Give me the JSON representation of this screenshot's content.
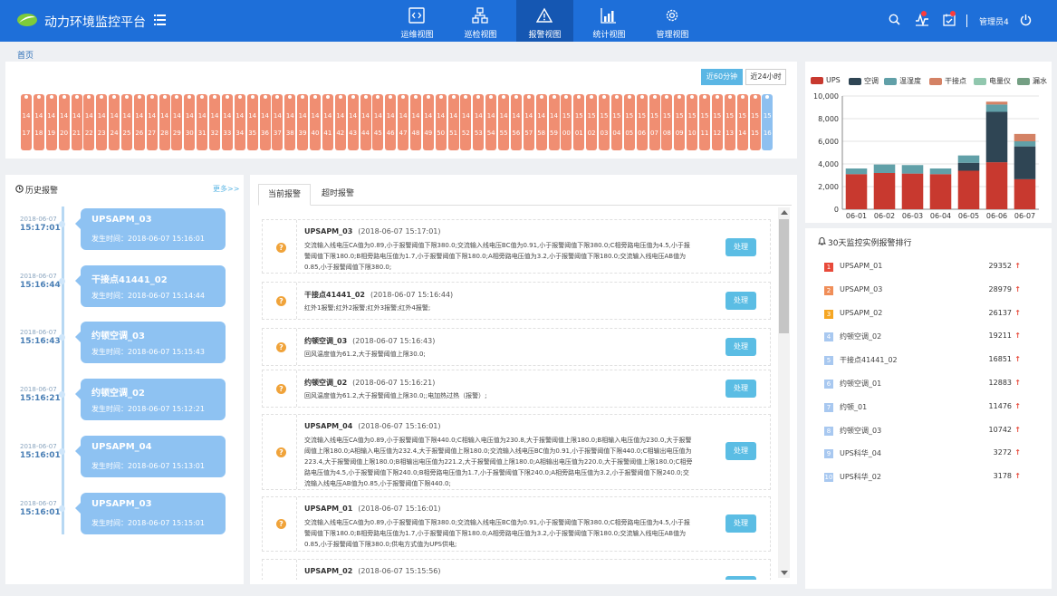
{
  "header": {
    "title": "动力环境监控平台",
    "nav": [
      {
        "label": "运维视图",
        "icon": "code-window-icon",
        "active": false
      },
      {
        "label": "巡检视图",
        "icon": "org-chart-icon",
        "active": false
      },
      {
        "label": "报警视图",
        "icon": "warning-icon",
        "active": true
      },
      {
        "label": "统计视图",
        "icon": "bar-chart-icon",
        "active": false
      },
      {
        "label": "管理视图",
        "icon": "gear-icon",
        "active": false
      }
    ],
    "user": "管理员4",
    "icons": [
      "search-icon",
      "alarm-pulse-icon",
      "calendar-check-icon",
      "power-icon"
    ],
    "colors": {
      "header_bg": "#1e6fd9",
      "nav_active_bg": "#1557b2",
      "badge": "#ff3b3b"
    }
  },
  "breadcrumb": "首页",
  "range_buttons": [
    {
      "label": "近60分钟",
      "active": true
    },
    {
      "label": "近24小时",
      "active": false
    }
  ],
  "minute_ticks": [
    {
      "h": "14",
      "m": "17",
      "c": "o"
    },
    {
      "h": "14",
      "m": "18",
      "c": "o"
    },
    {
      "h": "14",
      "m": "19",
      "c": "o"
    },
    {
      "h": "14",
      "m": "20",
      "c": "o"
    },
    {
      "h": "14",
      "m": "21",
      "c": "o"
    },
    {
      "h": "14",
      "m": "22",
      "c": "o"
    },
    {
      "h": "14",
      "m": "23",
      "c": "o"
    },
    {
      "h": "14",
      "m": "24",
      "c": "o"
    },
    {
      "h": "14",
      "m": "25",
      "c": "o"
    },
    {
      "h": "14",
      "m": "26",
      "c": "o"
    },
    {
      "h": "14",
      "m": "27",
      "c": "o"
    },
    {
      "h": "14",
      "m": "28",
      "c": "o"
    },
    {
      "h": "14",
      "m": "29",
      "c": "o"
    },
    {
      "h": "14",
      "m": "30",
      "c": "o"
    },
    {
      "h": "14",
      "m": "31",
      "c": "o"
    },
    {
      "h": "14",
      "m": "32",
      "c": "o"
    },
    {
      "h": "14",
      "m": "33",
      "c": "o"
    },
    {
      "h": "14",
      "m": "34",
      "c": "o"
    },
    {
      "h": "14",
      "m": "35",
      "c": "o"
    },
    {
      "h": "14",
      "m": "36",
      "c": "o"
    },
    {
      "h": "14",
      "m": "37",
      "c": "o"
    },
    {
      "h": "14",
      "m": "38",
      "c": "o"
    },
    {
      "h": "14",
      "m": "39",
      "c": "o"
    },
    {
      "h": "14",
      "m": "40",
      "c": "o"
    },
    {
      "h": "14",
      "m": "41",
      "c": "o"
    },
    {
      "h": "14",
      "m": "42",
      "c": "o"
    },
    {
      "h": "14",
      "m": "43",
      "c": "o"
    },
    {
      "h": "14",
      "m": "44",
      "c": "o"
    },
    {
      "h": "14",
      "m": "45",
      "c": "o"
    },
    {
      "h": "14",
      "m": "46",
      "c": "o"
    },
    {
      "h": "14",
      "m": "47",
      "c": "o"
    },
    {
      "h": "14",
      "m": "48",
      "c": "o"
    },
    {
      "h": "14",
      "m": "49",
      "c": "o"
    },
    {
      "h": "14",
      "m": "50",
      "c": "o"
    },
    {
      "h": "14",
      "m": "51",
      "c": "o"
    },
    {
      "h": "14",
      "m": "52",
      "c": "o"
    },
    {
      "h": "14",
      "m": "53",
      "c": "o"
    },
    {
      "h": "14",
      "m": "54",
      "c": "o"
    },
    {
      "h": "14",
      "m": "55",
      "c": "o"
    },
    {
      "h": "14",
      "m": "56",
      "c": "o"
    },
    {
      "h": "14",
      "m": "57",
      "c": "o"
    },
    {
      "h": "14",
      "m": "58",
      "c": "o"
    },
    {
      "h": "14",
      "m": "59",
      "c": "o"
    },
    {
      "h": "15",
      "m": "00",
      "c": "o"
    },
    {
      "h": "15",
      "m": "01",
      "c": "o"
    },
    {
      "h": "15",
      "m": "02",
      "c": "o"
    },
    {
      "h": "15",
      "m": "03",
      "c": "o"
    },
    {
      "h": "15",
      "m": "04",
      "c": "o"
    },
    {
      "h": "15",
      "m": "05",
      "c": "o"
    },
    {
      "h": "15",
      "m": "06",
      "c": "o"
    },
    {
      "h": "15",
      "m": "07",
      "c": "o"
    },
    {
      "h": "15",
      "m": "08",
      "c": "o"
    },
    {
      "h": "15",
      "m": "09",
      "c": "o"
    },
    {
      "h": "15",
      "m": "10",
      "c": "o"
    },
    {
      "h": "15",
      "m": "11",
      "c": "o"
    },
    {
      "h": "15",
      "m": "12",
      "c": "o"
    },
    {
      "h": "15",
      "m": "13",
      "c": "o"
    },
    {
      "h": "15",
      "m": "14",
      "c": "o"
    },
    {
      "h": "15",
      "m": "15",
      "c": "o"
    },
    {
      "h": "15",
      "m": "16",
      "c": "b"
    }
  ],
  "history": {
    "title": "历史报警",
    "more": "更多>>",
    "items": [
      {
        "date": "2018-06-07",
        "time": "15:17:01",
        "name": "UPSAPM_03",
        "occurred": "发生时间：2018-06-07 15:16:01"
      },
      {
        "date": "2018-06-07",
        "time": "15:16:44",
        "name": "干接点41441_02",
        "occurred": "发生时间：2018-06-07 15:14:44"
      },
      {
        "date": "2018-06-07",
        "time": "15:16:43",
        "name": "约顿空调_03",
        "occurred": "发生时间：2018-06-07 15:15:43"
      },
      {
        "date": "2018-06-07",
        "time": "15:16:21",
        "name": "约顿空调_02",
        "occurred": "发生时间：2018-06-07 15:12:21"
      },
      {
        "date": "2018-06-07",
        "time": "15:16:01",
        "name": "UPSAPM_04",
        "occurred": "发生时间：2018-06-07 15:13:01"
      },
      {
        "date": "2018-06-07",
        "time": "15:16:01",
        "name": "UPSAPM_03",
        "occurred": "发生时间：2018-06-07 15:15:01"
      }
    ]
  },
  "alarms": {
    "tabs": [
      {
        "label": "当前报警",
        "active": true
      },
      {
        "label": "超时报警",
        "active": false
      }
    ],
    "action_label": "处理",
    "items": [
      {
        "name": "UPSAPM_03",
        "time": "(2018-06-07 15:17:01)",
        "desc": "交流输入线电压CA值为0.89,小于报警阈值下限380.0;交流输入线电压BC值为0.91,小于报警阈值下限380.0;C相旁路电压值为4.5,小于报警阈值下限180.0;B相旁路电压值为1.7,小于报警阈值下限180.0;A相旁路电压值为3.2,小于报警阈值下限180.0;交流输入线电压AB值为0.85,小于报警阈值下限380.0;"
      },
      {
        "name": "干接点41441_02",
        "time": "(2018-06-07 15:16:44)",
        "desc": "红外1报警;红外2报警;红外3报警;红外4报警;"
      },
      {
        "name": "约顿空调_03",
        "time": "(2018-06-07 15:16:43)",
        "desc": "回风温度值为61.2,大于报警阈值上限30.0;"
      },
      {
        "name": "约顿空调_02",
        "time": "(2018-06-07 15:16:21)",
        "desc": "回风温度值为61.2,大于报警阈值上限30.0;;电加热过热（报警）;"
      },
      {
        "name": "UPSAPM_04",
        "time": "(2018-06-07 15:16:01)",
        "desc": "交流输入线电压CA值为0.89,小于报警阈值下限440.0;C相输入电压值为230.8,大于报警阈值上限180.0;B相输入电压值为230.0,大于报警阈值上限180.0;A相输入电压值为232.4,大于报警阈值上限180.0;交流输入线电压BC值为0.91,小于报警阈值下限440.0;C相输出电压值为223.4,大于报警阈值上限180.0;B相输出电压值为221.2,大于报警阈值上限180.0;A相输出电压值为220.0,大于报警阈值上限180.0;C相旁路电压值为4.5,小于报警阈值下限240.0;B相旁路电压值为1.7,小于报警阈值下限240.0;A相旁路电压值为3.2,小于报警阈值下限240.0;交流输入线电压AB值为0.85,小于报警阈值下限440.0;"
      },
      {
        "name": "UPSAPM_01",
        "time": "(2018-06-07 15:16:01)",
        "desc": "交流输入线电压CA值为0.89,小于报警阈值下限380.0;交流输入线电压BC值为0.91,小于报警阈值下限380.0;C相旁路电压值为4.5,小于报警阈值下限180.0;B相旁路电压值为1.7,小于报警阈值下限180.0;A相旁路电压值为3.2,小于报警阈值下限180.0;交流输入线电压AB值为0.85,小于报警阈值下限380.0;供电方式值为UPS供电;"
      },
      {
        "name": "UPSAPM_02",
        "time": "(2018-06-07 15:15:56)",
        "desc": ""
      }
    ]
  },
  "chart_data": {
    "type": "bar",
    "stacked": true,
    "categories": [
      "06-01",
      "06-02",
      "06-03",
      "06-04",
      "06-05",
      "06-06",
      "06-07"
    ],
    "series": [
      {
        "name": "UPS",
        "color": "#c8392f",
        "values": [
          3100,
          3200,
          3150,
          3100,
          3400,
          4150,
          2650
        ]
      },
      {
        "name": "空调",
        "color": "#2f4554",
        "values": [
          0,
          0,
          0,
          0,
          700,
          4450,
          2900
        ]
      },
      {
        "name": "温湿度",
        "color": "#61a0a8",
        "values": [
          500,
          750,
          750,
          500,
          650,
          650,
          450
        ]
      },
      {
        "name": "干接点",
        "color": "#d48265",
        "values": [
          0,
          0,
          0,
          0,
          0,
          250,
          650
        ]
      },
      {
        "name": "电量仪",
        "color": "#91c7ae",
        "values": [
          0,
          0,
          0,
          0,
          0,
          0,
          0
        ]
      },
      {
        "name": "漏水",
        "color": "#749f83",
        "values": [
          0,
          0,
          0,
          0,
          0,
          0,
          0
        ]
      }
    ],
    "ylim": [
      0,
      10000
    ],
    "yticks": [
      "0",
      "2,000",
      "4,000",
      "6,000",
      "8,000",
      "10,000"
    ],
    "ytick_values": [
      0,
      2000,
      4000,
      6000,
      8000,
      10000
    ],
    "grid": true,
    "legend": "top"
  },
  "ranking": {
    "title": "30天监控实例报警排行",
    "items": [
      {
        "rank": "1",
        "name": "UPSAPM_01",
        "value": "29352",
        "color": "#e84a3a"
      },
      {
        "rank": "2",
        "name": "UPSAPM_03",
        "value": "28979",
        "color": "#f08e58"
      },
      {
        "rank": "3",
        "name": "UPSAPM_02",
        "value": "26137",
        "color": "#f5a623"
      },
      {
        "rank": "4",
        "name": "约顿空调_02",
        "value": "19211",
        "color": "#a8c8f0"
      },
      {
        "rank": "5",
        "name": "干接点41441_02",
        "value": "16851",
        "color": "#a8c8f0"
      },
      {
        "rank": "6",
        "name": "约顿空调_01",
        "value": "12883",
        "color": "#a8c8f0"
      },
      {
        "rank": "7",
        "name": "约顿_01",
        "value": "11476",
        "color": "#a8c8f0"
      },
      {
        "rank": "8",
        "name": "约顿空调_03",
        "value": "10742",
        "color": "#a8c8f0"
      },
      {
        "rank": "9",
        "name": "UPS科华_04",
        "value": "3272",
        "color": "#a8c8f0"
      },
      {
        "rank": "10",
        "name": "UPS科华_02",
        "value": "3178",
        "color": "#a8c8f0"
      }
    ],
    "trend_icon": "up-arrow-icon"
  }
}
